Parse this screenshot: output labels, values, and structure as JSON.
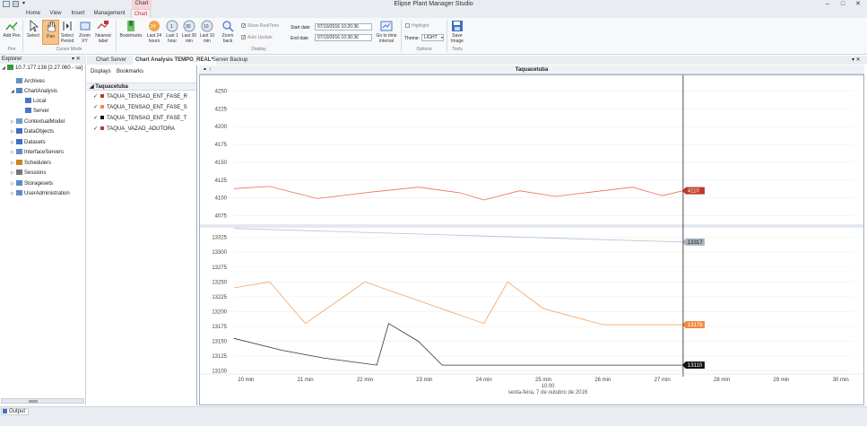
{
  "app": {
    "title": "Elipse Plant Manager Studio",
    "context_tab": "Chart",
    "window_buttons": [
      "–",
      "□",
      "✕"
    ]
  },
  "menu": {
    "tabs": [
      "Home",
      "View",
      "Insert",
      "Management",
      "Chart"
    ],
    "active": "Chart"
  },
  "ribbon": {
    "pen_group": {
      "add_pen": "Add Pen",
      "label": "Pen"
    },
    "cursor_group": {
      "select": "Select",
      "pan": "Pan",
      "select_period": "Select Period",
      "zoom_xy": "Zoom XY",
      "nearest_label": "Nearest label",
      "label": "Cursor Mode"
    },
    "display_group": {
      "bookmarks": "Bookmarks",
      "last24": "Last 24 hours",
      "last1": "Last 1 hour",
      "last30": "Last 30 min",
      "last10": "Last 10 min",
      "zoom_back": "Zoom back",
      "show_realtime": "Show RealTime",
      "auto_update": "Auto Update",
      "start_label": "Start date",
      "start_value": "07/10/2016 10:20:36",
      "end_label": "End date",
      "end_value": "07/10/2016 10:30:36",
      "goto_interval": "Go to time interval",
      "label": "Display",
      "badge_24": "24",
      "badge_1": "1",
      "badge_30": "30",
      "badge_10": "10"
    },
    "options_group": {
      "highlight": "Highlight",
      "theme_label": "Theme:",
      "theme_value": "LIGHT",
      "label": "Options"
    },
    "tools_group": {
      "save_image": "Save Image",
      "label": "Tools"
    }
  },
  "explorer": {
    "title": "Explorer",
    "root": "10.7.177.138 [2.27.060 - sa]",
    "items": [
      {
        "label": "Archives",
        "depth": 1,
        "expand": "",
        "color": "#6b8cc7"
      },
      {
        "label": "ChartAnalysis",
        "depth": 1,
        "expand": "◢",
        "color": "#5a7fc0"
      },
      {
        "label": "Local",
        "depth": 2,
        "expand": "",
        "color": "#4a74c9"
      },
      {
        "label": "Server",
        "depth": 2,
        "expand": "",
        "color": "#4a74c9"
      },
      {
        "label": "ContextualModel",
        "depth": 1,
        "expand": "▷",
        "color": "#6f9ad1"
      },
      {
        "label": "DataObjects",
        "depth": 1,
        "expand": "▷",
        "color": "#3d6fc2"
      },
      {
        "label": "Datasets",
        "depth": 1,
        "expand": "▷",
        "color": "#3d6fc2"
      },
      {
        "label": "InterfaceServers",
        "depth": 1,
        "expand": "▷",
        "color": "#5f8ac8"
      },
      {
        "label": "Schedulers",
        "depth": 1,
        "expand": "▷",
        "color": "#c9851f"
      },
      {
        "label": "Sessions",
        "depth": 1,
        "expand": "▷",
        "color": "#777777"
      },
      {
        "label": "Storagesets",
        "depth": 1,
        "expand": "▷",
        "color": "#5f8ac8"
      },
      {
        "label": "UserAdministration",
        "depth": 1,
        "expand": "▷",
        "color": "#5f8ac8"
      }
    ]
  },
  "doc_tabs": {
    "items": [
      "Chart Server",
      "Chart Analysis TEMPO_REAL*",
      "Server Backup"
    ],
    "active": 1
  },
  "series_panel": {
    "tabs": [
      "Displays",
      "Bookmarks"
    ],
    "group": "Taquacetuba",
    "series": [
      {
        "name": "TAQUA_TENSAO_ENT_FASE_R",
        "color": "#c0392b"
      },
      {
        "name": "TAQUA_TENSAO_ENT_FASE_S",
        "color": "#f08a3c"
      },
      {
        "name": "TAQUA_TENSAO_ENT_FASE_T",
        "color": "#111111"
      },
      {
        "name": "TAQUA_VAZAO_ADUTORA",
        "color": "#c0392b"
      }
    ]
  },
  "chart": {
    "title": "Taquacetuba",
    "time_caption": "10:00",
    "date_caption": "sexta-feira, 7 de outubro de 2016"
  },
  "chart_data": {
    "type": "line",
    "x_ticks": [
      "20 min",
      "21 min",
      "22 min",
      "23 min",
      "24 min",
      "25 min",
      "26 min",
      "27 min",
      "28 min",
      "29 min",
      "30 min"
    ],
    "xlim": [
      19.8,
      30.2
    ],
    "cursor_x": 27.35,
    "panes": [
      {
        "yticks": [
          4075,
          4100,
          4125,
          4150,
          4175,
          4200,
          4225,
          4250
        ],
        "ylim": [
          4068,
          4262
        ],
        "series": [
          {
            "color": "#e8705a",
            "x": [
              19.8,
              20.4,
              21.2,
              22.1,
              22.9,
              23.6,
              24.0,
              24.6,
              25.2,
              25.8,
              26.5,
              27.0,
              27.35
            ],
            "y": [
              4113,
              4116,
              4099,
              4108,
              4115,
              4107,
              4097,
              4110,
              4102,
              4108,
              4115,
              4103,
              4110
            ]
          }
        ],
        "labels": [
          {
            "text": "4110",
            "value": 4110,
            "color": "#c0392b",
            "fg": "#ffffff"
          }
        ]
      },
      {
        "yticks": [
          13100,
          13125,
          13150,
          13175,
          13200,
          13225,
          13250,
          13275,
          13300,
          13325
        ],
        "ylim": [
          13095,
          13335
        ],
        "series": [
          {
            "color": "#b8c1cc",
            "x": [
              19.8,
              27.35
            ],
            "y": [
              13340,
              13317
            ]
          },
          {
            "color": "#f4a05a",
            "x": [
              19.8,
              20.4,
              21.0,
              22.0,
              23.0,
              24.0,
              24.4,
              25.0,
              26.0,
              27.35
            ],
            "y": [
              13240,
              13250,
              13180,
              13250,
              13215,
              13180,
              13250,
              13205,
              13178,
              13178
            ]
          },
          {
            "color": "#333333",
            "x": [
              19.8,
              20.6,
              21.3,
              22.2,
              22.4,
              22.9,
              23.3,
              27.35
            ],
            "y": [
              13155,
              13135,
              13122,
              13110,
              13180,
              13150,
              13110,
              13110
            ]
          }
        ],
        "labels": [
          {
            "text": "13317",
            "value": 13317,
            "color": "#a9b4c0",
            "fg": "#222222"
          },
          {
            "text": "13178",
            "value": 13178,
            "color": "#f08a3c",
            "fg": "#ffffff"
          },
          {
            "text": "13110",
            "value": 13110,
            "color": "#111111",
            "fg": "#ffffff"
          }
        ]
      }
    ]
  },
  "status": {
    "output": "Output"
  }
}
